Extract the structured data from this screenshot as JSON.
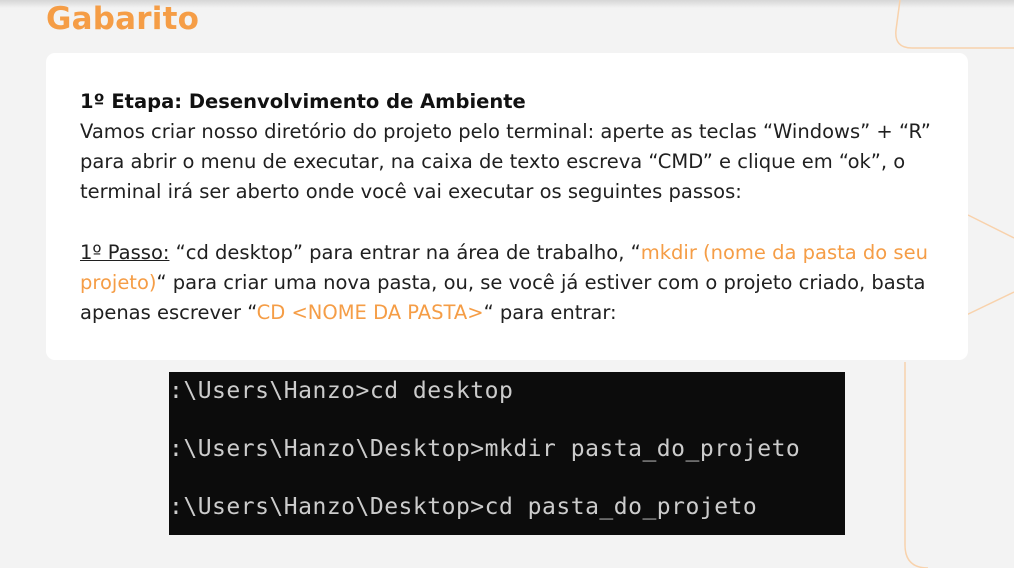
{
  "page": {
    "title": "Gabarito"
  },
  "card": {
    "heading": "1º Etapa: Desenvolvimento de Ambiente",
    "paragraph1": "Vamos criar nosso diretório do projeto pelo terminal: aperte as teclas “Windows” + “R” para abrir o menu de executar, na caixa de texto escreva “CMD” e clique em “ok”, o terminal irá ser aberto onde você vai executar os seguintes passos:",
    "step_label": "1º Passo:",
    "step_text1": " “cd desktop” para entrar na área de trabalho, “",
    "step_highlight1": "mkdir (nome da pasta do seu projeto)",
    "step_text2": "“ para criar uma nova pasta, ou, se você já estiver com o projeto criado, basta apenas escrever “",
    "step_highlight2": "CD <NOME DA PASTA>",
    "step_text3": "“ para entrar:"
  },
  "terminal": {
    "lines": [
      ":\\Users\\Hanzo>cd desktop",
      ":\\Users\\Hanzo\\Desktop>mkdir pasta_do_projeto",
      ":\\Users\\Hanzo\\Desktop>cd pasta_do_projeto"
    ]
  },
  "colors": {
    "accent": "#f59d46",
    "card_background": "#ffffff",
    "page_background": "#f3f3f3",
    "terminal_background": "#0c0c0c",
    "terminal_text": "#cccccc"
  }
}
